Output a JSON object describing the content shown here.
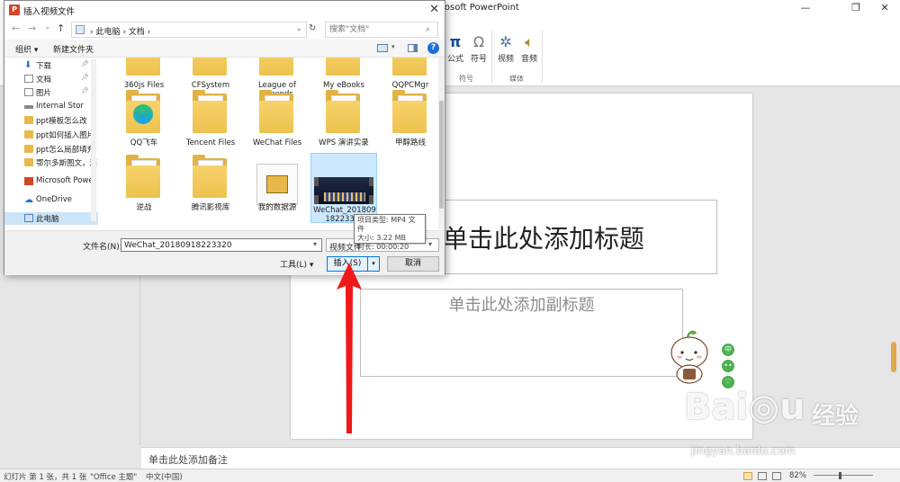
{
  "ppt": {
    "title": "rosoft PowerPoint",
    "win_minimize": "—",
    "win_restore": "❐",
    "win_close": "✕",
    "ribbon": {
      "equation_label": "公式",
      "symbol_label": "符号",
      "video_label": "视频",
      "audio_label": "音频",
      "group_symbols": "符号",
      "group_media": "媒体"
    },
    "slide": {
      "title_placeholder": "单击此处添加标题",
      "subtitle_placeholder": "单击此处添加副标题"
    },
    "side_buttons": [
      "中",
      "••",
      "♡"
    ],
    "notes_placeholder": "单击此处添加备注",
    "status": {
      "slide_count": "幻灯片 第 1 张，共 1 张",
      "theme": "\"Office 主题\"",
      "language": "中文(中国)",
      "zoom": "82%"
    },
    "watermark": {
      "logo": "Bai◎u",
      "text": "经验",
      "url": "jingyan.baidu.com"
    }
  },
  "dialog": {
    "app_icon": "P",
    "title": "插入视频文件",
    "close": "✕",
    "nav": {
      "back": "←",
      "forward": "→",
      "recent": "⌄",
      "up": "↑"
    },
    "address": "›  此电脑  ›  文档  ›",
    "refresh": "↻",
    "search_placeholder": "搜索\"文档\"",
    "toolbar": {
      "organize": "组织 ▾",
      "new_folder": "新建文件夹",
      "help": "?"
    },
    "nav_pane": [
      {
        "label": "下载",
        "icon": "down",
        "pin": true
      },
      {
        "label": "文档",
        "icon": "doc",
        "pin": true
      },
      {
        "label": "图片",
        "icon": "doc",
        "pin": true
      },
      {
        "label": "Internal Stor",
        "icon": "drive",
        "pin": false
      },
      {
        "label": "ppt模板怎么改",
        "icon": "folder",
        "pin": false
      },
      {
        "label": "ppt如何插入图片",
        "icon": "folder",
        "pin": false
      },
      {
        "label": "ppt怎么局部填充",
        "icon": "folder",
        "pin": false
      },
      {
        "label": "鄂尔多斯图文，连",
        "icon": "folder",
        "pin": false
      },
      {
        "label": "Microsoft Power",
        "icon": "ppt",
        "pin": false
      },
      {
        "label": "OneDrive",
        "icon": "cloud",
        "pin": false
      },
      {
        "label": "此电脑",
        "icon": "pc",
        "pin": false,
        "selected": true
      }
    ],
    "files": [
      {
        "label": "360js Files",
        "kind": "folder-partial"
      },
      {
        "label": "CFSystem",
        "kind": "folder-partial"
      },
      {
        "label": "League of Legends",
        "kind": "folder-partial"
      },
      {
        "label": "My eBooks",
        "kind": "folder-partial"
      },
      {
        "label": "QQPCMgr",
        "kind": "folder-partial"
      },
      {
        "label": "QQ飞车",
        "kind": "folder"
      },
      {
        "label": "Tencent Files",
        "kind": "folder"
      },
      {
        "label": "WeChat Files",
        "kind": "folder"
      },
      {
        "label": "WPS 演讲实录",
        "kind": "folder"
      },
      {
        "label": "甲醇路线",
        "kind": "folder"
      },
      {
        "label": "逆战",
        "kind": "folder"
      },
      {
        "label": "腾讯影视库",
        "kind": "folder"
      },
      {
        "label": "我的数据源",
        "kind": "datasource"
      },
      {
        "label": "WeChat_20180918223320",
        "kind": "video",
        "selected": true
      }
    ],
    "tooltip": {
      "type": "项目类型: MP4 文件",
      "size": "大小: 3.22 MB",
      "duration": "时长: 00:00:20"
    },
    "filename_label": "文件名(N):",
    "filename_value": "WeChat_20180918223320",
    "filetype_value": "视频文件",
    "tools_label": "工具(L)  ▾",
    "insert_label": "插入(S)",
    "insert_dropdown": "▾",
    "cancel_label": "取消"
  }
}
